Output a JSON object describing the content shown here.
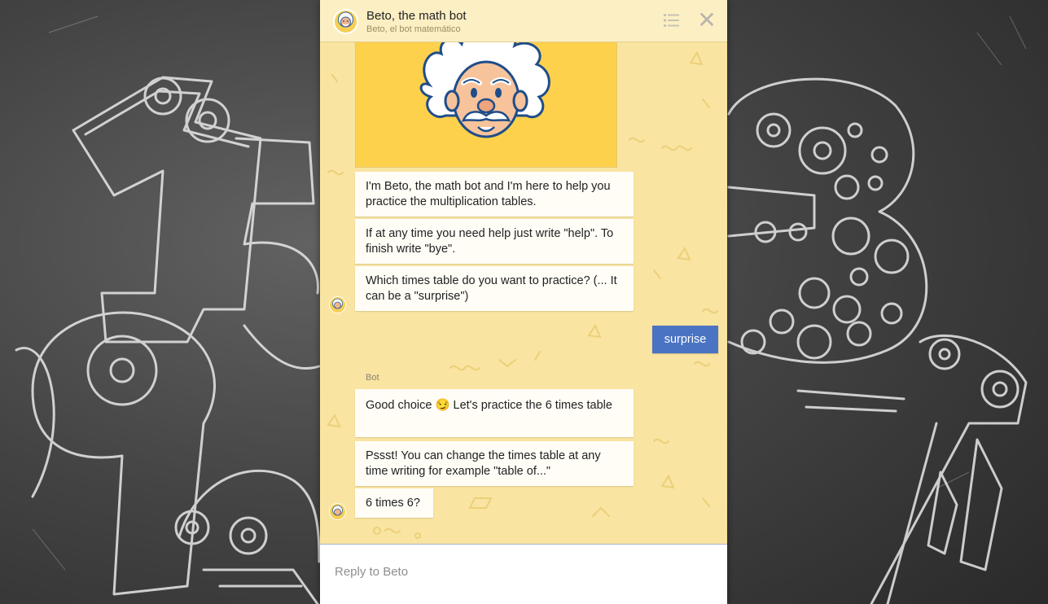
{
  "header": {
    "title": "Beto, the math bot",
    "subtitle": "Beto, el bot matemático",
    "list_icon": "list-icon",
    "close_icon": "close-icon",
    "close_glyph": "✕"
  },
  "messages": {
    "bot_group_1": [
      "I'm Beto, the math bot and I'm here to help you practice the multiplication tables.",
      "If at any time you need help just write \"help\". To finish write \"bye\".",
      "Which times table do you want to practice? (... It can be a \"surprise\")"
    ],
    "user_reply": "surprise",
    "sender_label": "Bot",
    "bot_group_2": [
      "Good choice 😏 Let's practice the 6 times table",
      "Pssst! You can change the times table at any time writing for example \"table of...\"",
      "6 times 6?"
    ]
  },
  "composer": {
    "placeholder": "Reply to Beto"
  },
  "colors": {
    "chat_background": "#f9e4a1",
    "user_bubble": "#4a73c3",
    "bot_bubble": "#fffdf6",
    "chalkboard": "#3c3c3c"
  }
}
